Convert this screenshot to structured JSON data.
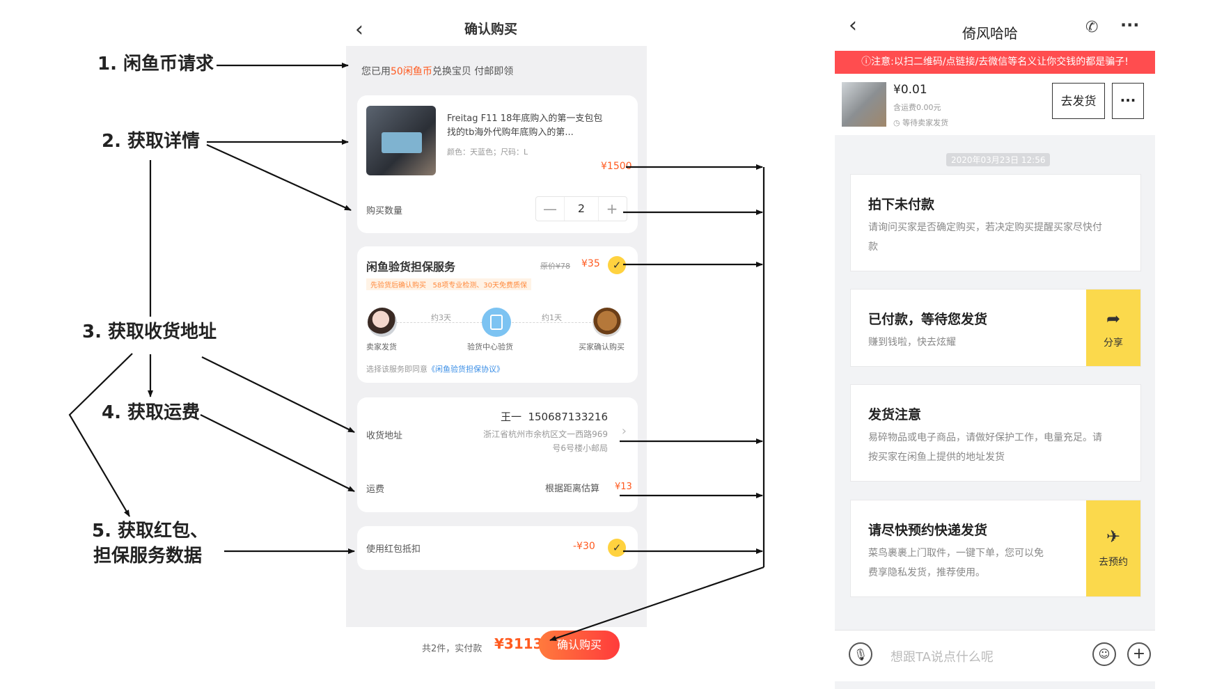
{
  "steps": {
    "s1": "1. 闲鱼币请求",
    "s2": "2. 获取详情",
    "s3": "3. 获取收货地址",
    "s4": "4. 获取运费",
    "s5_line1": "5. 获取红包、",
    "s5_line2": "担保服务数据"
  },
  "left_phone": {
    "title": "确认购买",
    "coin_banner": {
      "prefix": "您已用",
      "highlight": "50闲鱼币",
      "suffix": "兑换宝贝 付邮即领"
    },
    "product": {
      "name_line1": "Freitag F11 18年底购入的第一支包包",
      "name_line2": "找的tb海外代购年底购入的第...",
      "spec": "颜色：天蓝色；尺码：L",
      "price": "¥1500"
    },
    "quantity": {
      "label": "购买数量",
      "minus": "—",
      "value": "2",
      "plus": "+"
    },
    "inspection": {
      "title": "闲鱼验货担保服务",
      "old_price": "原价¥78",
      "price": "¥35",
      "tags": "先验货后确认购买   58项专业检测、30天免费质保",
      "step1": "卖家发货",
      "days1": "约3天",
      "step2": "验货中心验货",
      "days2": "约1天",
      "step3": "买家确认购买",
      "agree_prefix": "选择该服务即同意",
      "agree_link": "《闲鱼验货担保协议》"
    },
    "address": {
      "label": "收货地址",
      "name_phone": "王一  150687133216",
      "line1": "浙江省杭州市余杭区文一西路969",
      "line2": "号6号楼小邮局"
    },
    "shipping": {
      "label": "运费",
      "desc": "根据距离估算",
      "value": "¥13"
    },
    "redpacket": {
      "label": "使用红包抵扣",
      "value": "-¥30"
    },
    "footer": {
      "count_label": "共2件，实付款",
      "total": "¥3113",
      "button": "确认购买"
    }
  },
  "right_phone": {
    "title": "倚风哈哈",
    "warning": "ⓘ注意:以扫二维码/点链接/去微信等名义让你交钱的都是骗子!",
    "order": {
      "price": "¥0.01",
      "shipping_fee": "含运费0.00元",
      "status": "等待卖家发货",
      "ship_button": "去发货",
      "more_button": "···"
    },
    "timestamp": "2020年03月23日 12:56",
    "cards": [
      {
        "title": "拍下未付款",
        "body1": "请询问买家是否确定购买，若决定购买提醒买家尽快付",
        "body2": "款"
      },
      {
        "title": "已付款，等待您发货",
        "body1": "赚到钱啦，快去炫耀",
        "action": "分享"
      },
      {
        "title": "发货注意",
        "body1": "易碎物品或电子商品，请做好保护工作，电量充足。请",
        "body2": "按买家在闲鱼上提供的地址发货"
      },
      {
        "title": "请尽快预约快递发货",
        "body1": "菜鸟裹裹上门取件，一键下单，您可以免",
        "body2": "费享隐私发货，推荐使用。",
        "action": "去预约"
      }
    ],
    "input_placeholder": "想跟TA说点什么呢"
  }
}
